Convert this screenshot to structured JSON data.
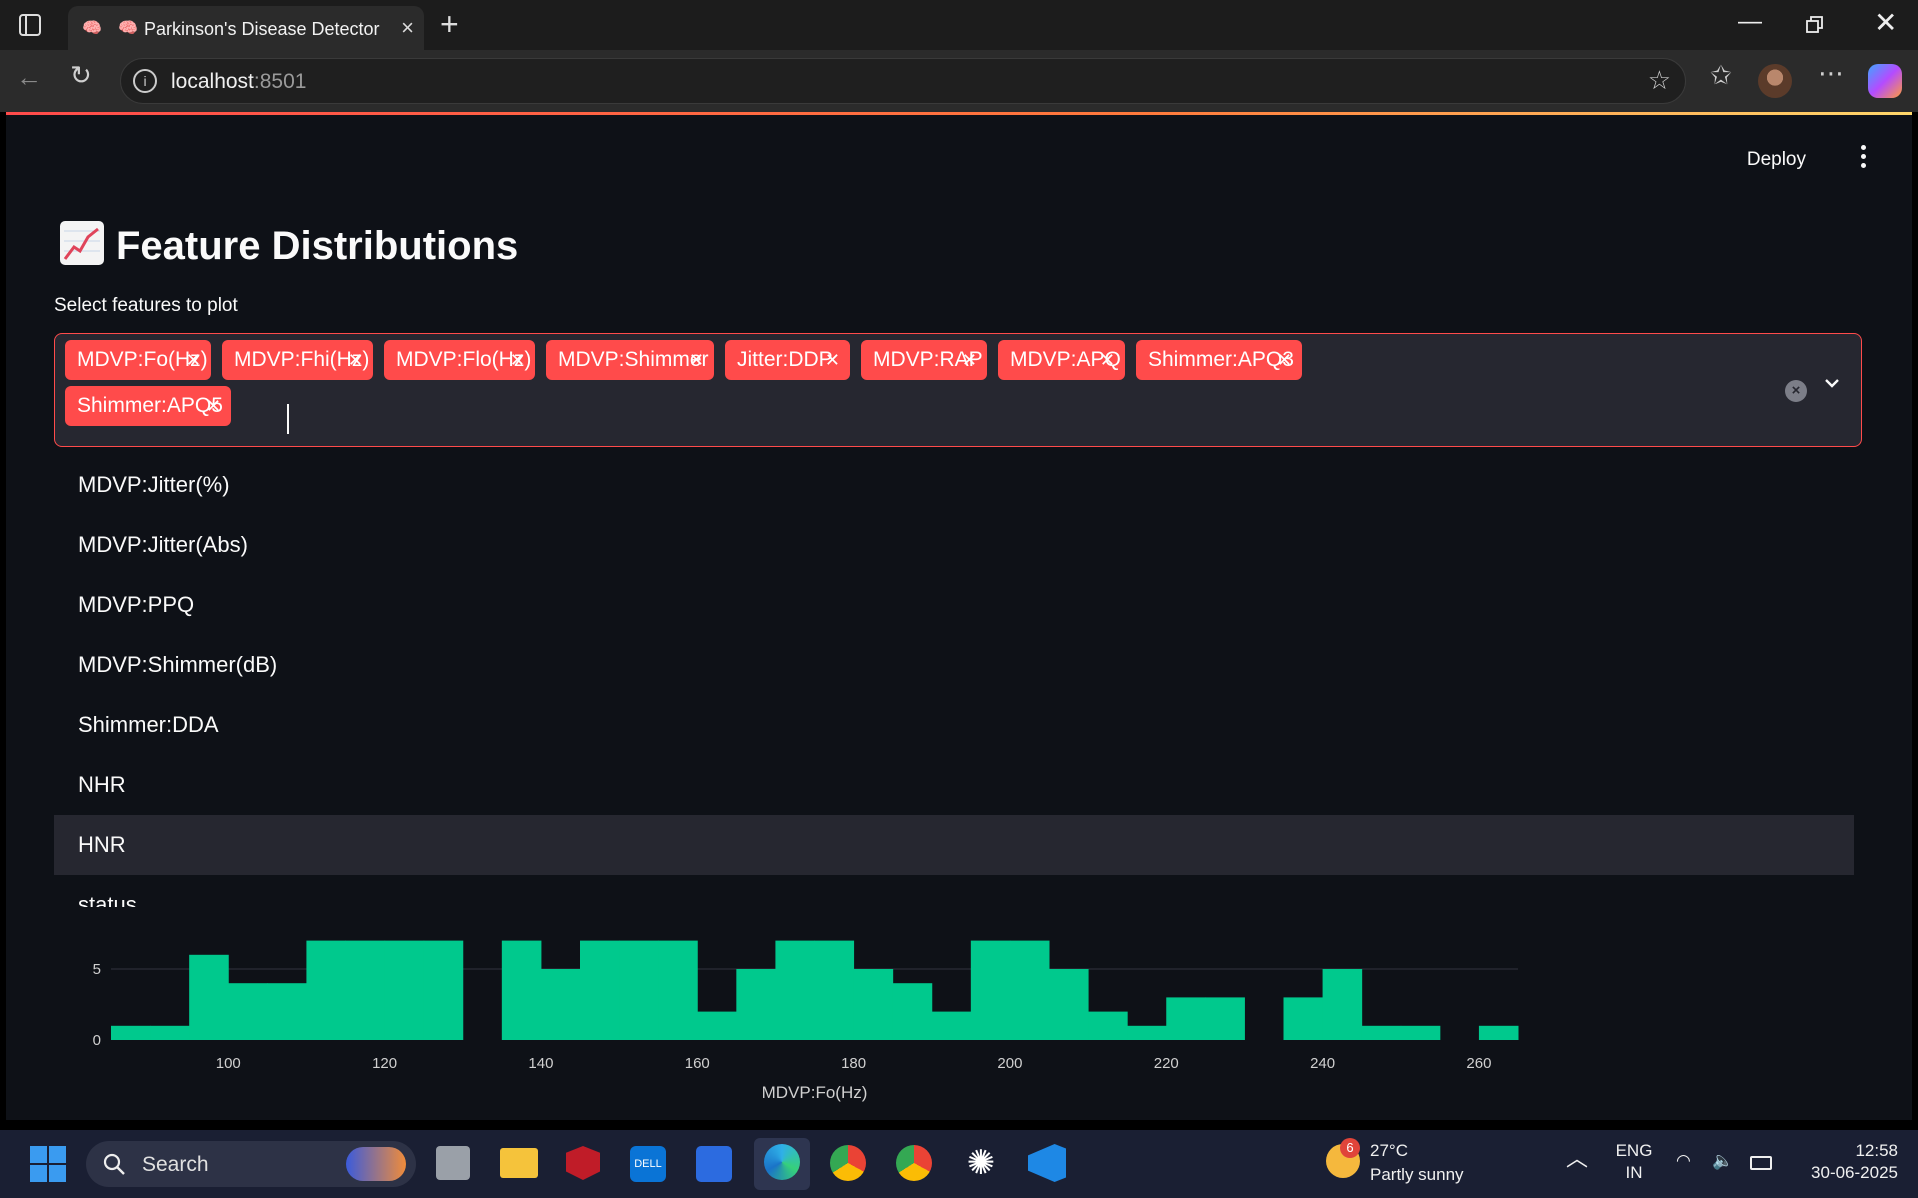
{
  "browser": {
    "tab_title": "Parkinson's Disease Detector",
    "tab_favicon": "🧠",
    "url_host": "localhost",
    "url_port": ":8501"
  },
  "app": {
    "deploy_label": "Deploy",
    "heading_text": "Feature Distributions",
    "select_label": "Select features to plot",
    "selected_features": [
      "MDVP:Fo(Hz)",
      "MDVP:Fhi(Hz)",
      "MDVP:Flo(Hz)",
      "MDVP:Shimmer",
      "Jitter:DDP",
      "MDVP:RAP",
      "MDVP:APQ",
      "Shimmer:APQ3",
      "Shimmer:APQ5"
    ],
    "dropdown_options": [
      "MDVP:Jitter(%)",
      "MDVP:Jitter(Abs)",
      "MDVP:PPQ",
      "MDVP:Shimmer(dB)",
      "Shimmer:DDA",
      "NHR",
      "HNR",
      "status"
    ],
    "highlighted_option": "HNR",
    "accent_color": "#ff4b4b"
  },
  "chart_data": {
    "type": "bar",
    "xlabel": "MDVP:Fo(Hz)",
    "x_ticks": [
      100,
      120,
      140,
      160,
      180,
      200,
      220,
      240,
      260
    ],
    "y_ticks": [
      0,
      5
    ],
    "bin_width": 5,
    "bins_start": [
      85,
      90,
      95,
      100,
      105,
      110,
      115,
      120,
      125,
      130,
      135,
      140,
      145,
      150,
      155,
      160,
      165,
      170,
      175,
      180,
      185,
      190,
      195,
      200,
      205,
      210,
      215,
      220,
      225,
      230,
      235,
      240,
      245,
      250,
      255,
      260
    ],
    "values": [
      1,
      1,
      6,
      4,
      4,
      7,
      7,
      7,
      7,
      0,
      7,
      5,
      7,
      7,
      7,
      2,
      5,
      7,
      7,
      5,
      4,
      2,
      7,
      7,
      5,
      2,
      1,
      3,
      3,
      0,
      3,
      5,
      1,
      1,
      0,
      1
    ],
    "bar_color": "#00c98d"
  },
  "taskbar": {
    "search_label": "Search",
    "weather_temp": "27°C",
    "weather_desc": "Partly sunny",
    "weather_badge": "6",
    "lang_line1": "ENG",
    "lang_line2": "IN",
    "time": "12:58",
    "date": "30-06-2025"
  }
}
